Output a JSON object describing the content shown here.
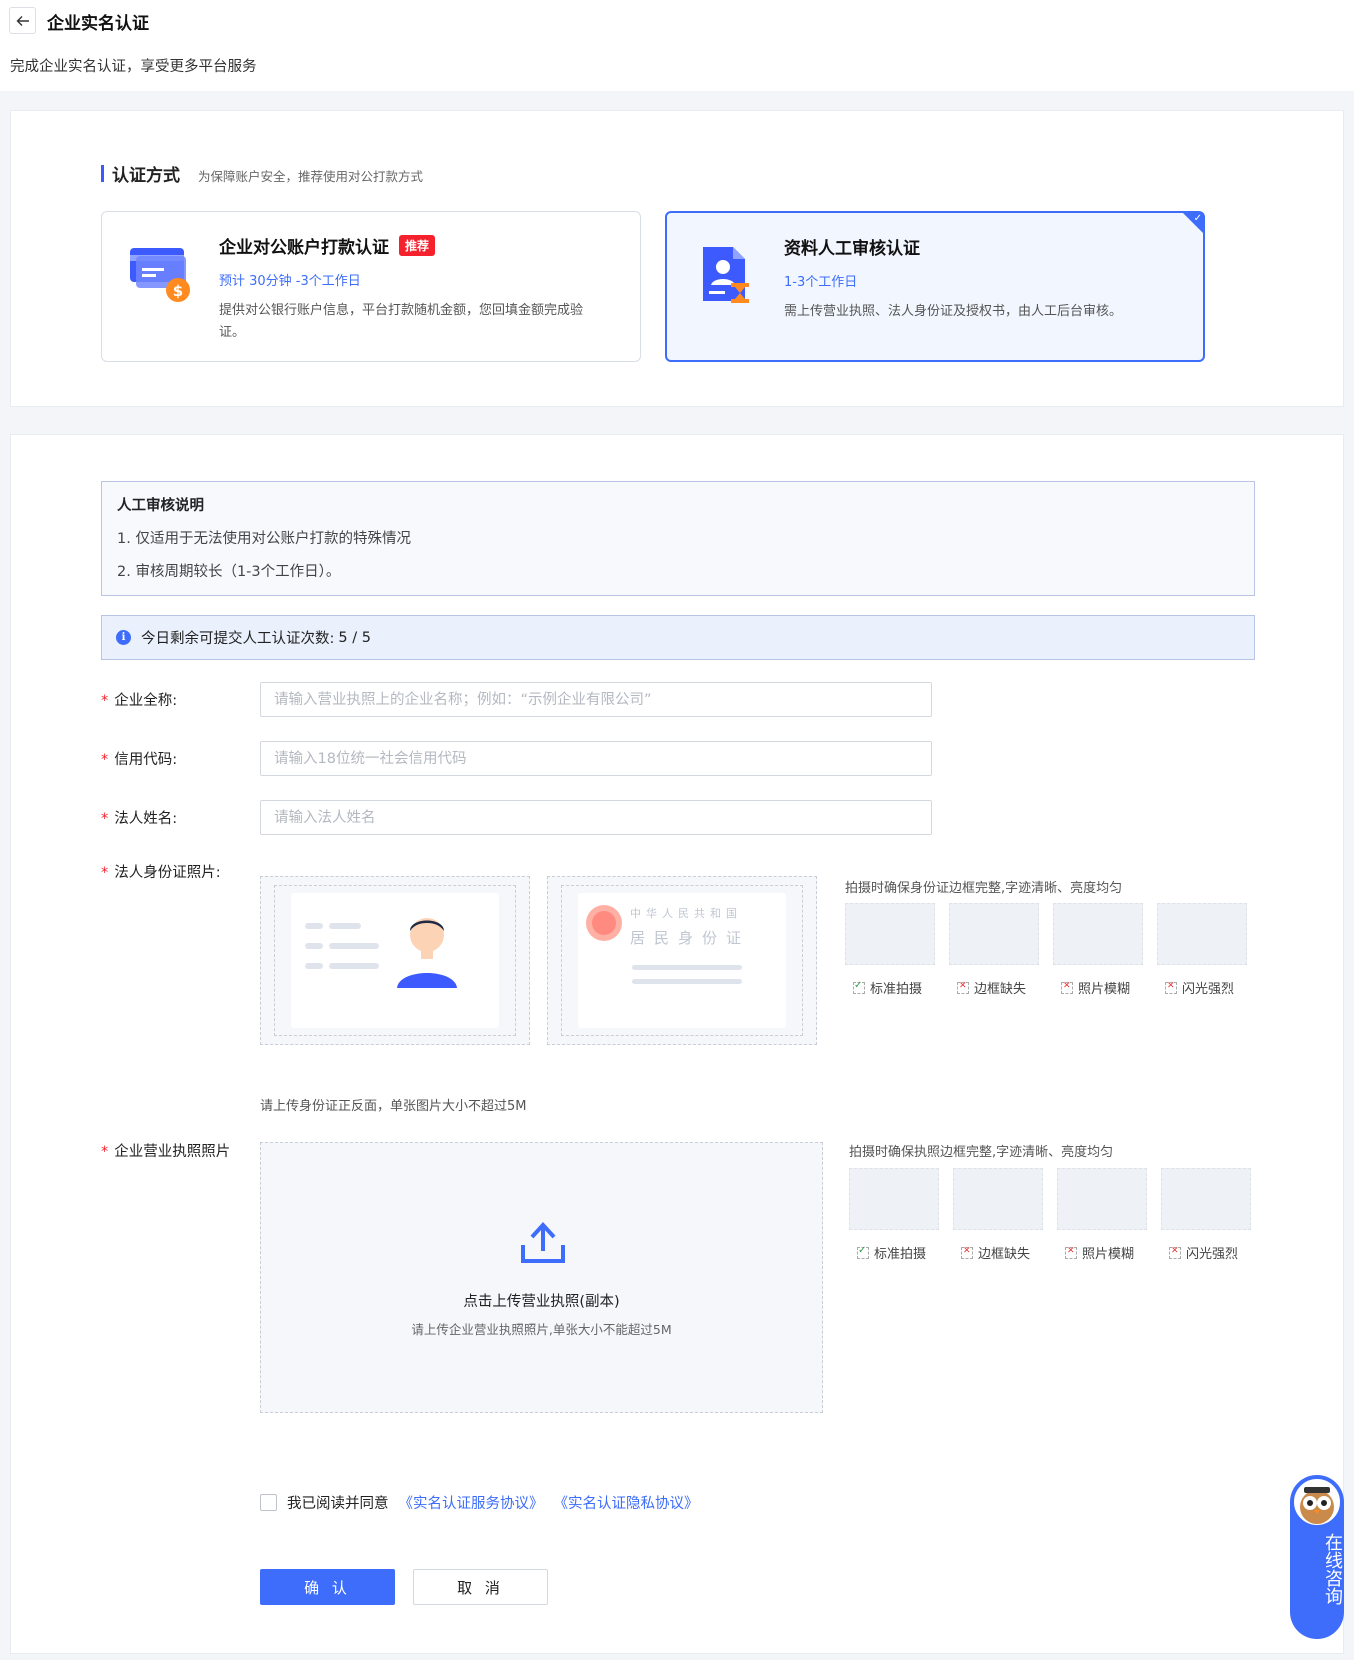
{
  "header": {
    "title": "企业实名认证",
    "subtitle": "完成企业实名认证，享受更多平台服务"
  },
  "auth_section": {
    "title": "认证方式",
    "hint": "为保障账户安全，推荐使用对公打款方式",
    "methods": [
      {
        "title": "企业对公账户打款认证",
        "badge": "推荐",
        "time": "预计 30分钟 -3个工作日",
        "desc": "提供对公银行账户信息，平台打款随机金额，您回填金额完成验证。",
        "selected": false
      },
      {
        "title": "资料人工审核认证",
        "time": "1-3个工作日",
        "desc": "需上传营业执照、法人身份证及授权书，由人工后台审核。",
        "selected": true
      }
    ]
  },
  "notice": {
    "title": "人工审核说明",
    "lines": [
      "1. 仅适用于无法使用对公账户打款的特殊情况",
      "2. 审核周期较长（1-3个工作日）。"
    ]
  },
  "remaining": {
    "icon": "info-icon",
    "label": "今日剩余可提交人工认证次数:",
    "count": "5 / 5"
  },
  "form": {
    "company_name": {
      "label": "企业全称:",
      "placeholder": "请输入营业执照上的企业名称；例如：“示例企业有限公司”"
    },
    "credit_code": {
      "label": "信用代码:",
      "placeholder": "请输入18位统一社会信用代码"
    },
    "legal_name": {
      "label": "法人姓名:",
      "placeholder": "请输入法人姓名"
    },
    "id_photo": {
      "label": "法人身份证照片:",
      "back_title": "中华人民共和国",
      "back_subtitle": "居民身份证",
      "guide": "拍摄时确保身份证边框完整,字迹清晰、亮度均匀",
      "hint": "请上传身份证正反面，单张图片大小不超过5M",
      "samples": [
        "标准拍摄",
        "边框缺失",
        "照片模糊",
        "闪光强烈"
      ]
    },
    "license": {
      "label": "企业营业执照照片",
      "guide": "拍摄时确保执照边框完整,字迹清晰、亮度均匀",
      "upload_title": "点击上传营业执照(副本)",
      "upload_hint": "请上传企业营业执照照片,单张大小不能超过5M",
      "samples": [
        "标准拍摄",
        "边框缺失",
        "照片模糊",
        "闪光强烈"
      ]
    },
    "required_mark": "*"
  },
  "agreement": {
    "text": "我已阅读并同意",
    "link1": "《实名认证服务协议》",
    "link2": "《实名认证隐私协议》"
  },
  "buttons": {
    "confirm": "确 认",
    "cancel": "取 消"
  },
  "consult": {
    "label": "在线咨询"
  },
  "colors": {
    "primary": "#3d6dfa",
    "danger": "#f5222d",
    "accent_bar": "#3d5afe"
  }
}
